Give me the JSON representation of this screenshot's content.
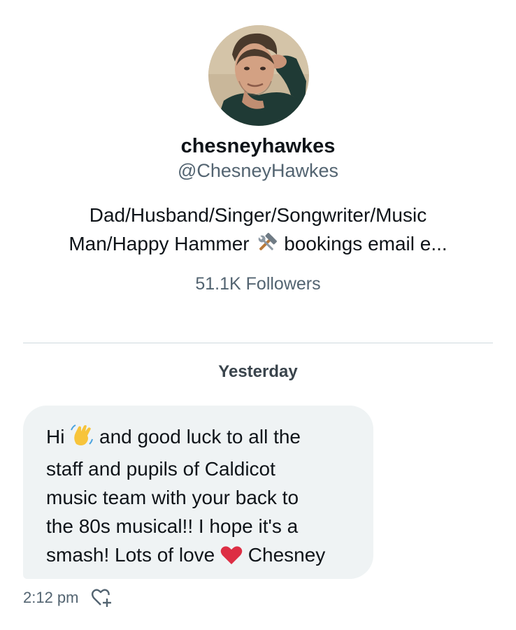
{
  "profile": {
    "display_name": "chesneyhawkes",
    "handle": "@ChesneyHawkes",
    "bio_line1": "Dad/Husband/Singer/Songwriter/Music",
    "bio_line2_before": "Man/Happy Hammer",
    "bio_emoji": "hammer-and-wrench-icon",
    "bio_line2_after": "bookings email e...",
    "followers": "51.1K Followers"
  },
  "conversation": {
    "date_separator": "Yesterday",
    "message": {
      "line1_before": "Hi",
      "line1_emoji": "waving-hand-icon",
      "line1_after": "and good luck to all the",
      "line2": "staff and pupils of Caldicot",
      "line3": "music team with your back to",
      "line4": "the 80s musical!! I hope it's a",
      "line5_before": "smash! Lots of love",
      "line5_emoji": "red-heart-icon",
      "line5_after": "Chesney",
      "timestamp": "2:12 pm",
      "bubble_color": "#eff3f4"
    }
  },
  "colors": {
    "primary_text": "#0f1419",
    "secondary_text": "#536471",
    "heart": "#e0245e"
  }
}
